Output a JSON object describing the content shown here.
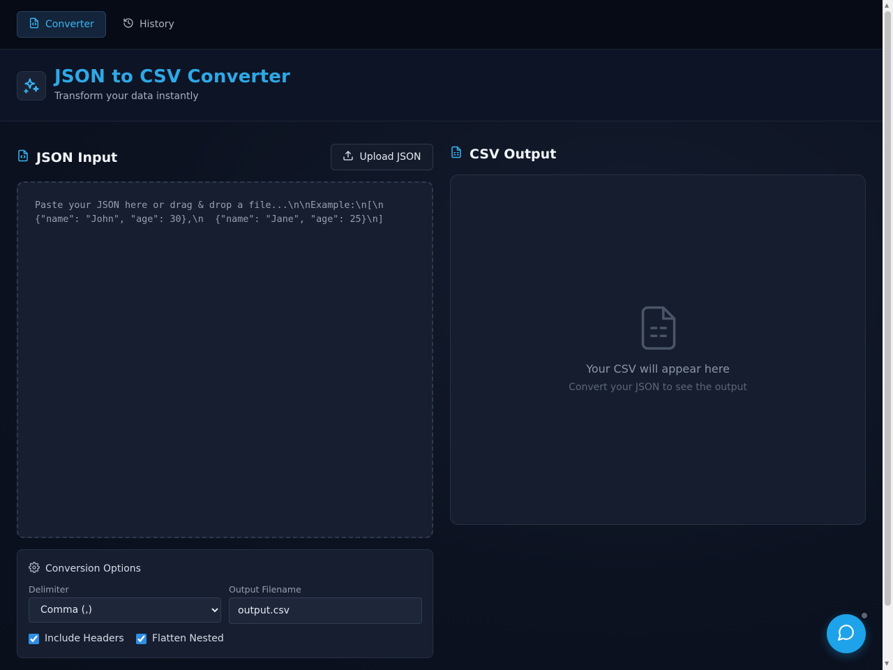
{
  "nav": {
    "converter": "Converter",
    "history": "History"
  },
  "header": {
    "title": "JSON to CSV Converter",
    "subtitle": "Transform your data instantly"
  },
  "input_panel": {
    "title": "JSON Input",
    "upload_label": "Upload JSON",
    "placeholder": "Paste your JSON here or drag & drop a file...\\n\\nExample:\\n[\\n  {\"name\": \"John\", \"age\": 30},\\n  {\"name\": \"Jane\", \"age\": 25}\\n]"
  },
  "output_panel": {
    "title": "CSV Output",
    "empty_title": "Your CSV will appear here",
    "empty_subtitle": "Convert your JSON to see the output"
  },
  "options": {
    "title": "Conversion Options",
    "delimiter_label": "Delimiter",
    "delimiter_value": "Comma (,)",
    "filename_label": "Output Filename",
    "filename_value": "output.csv",
    "include_headers": "Include Headers",
    "include_headers_checked": true,
    "flatten_nested": "Flatten Nested",
    "flatten_nested_checked": true
  },
  "colors": {
    "accent": "#2ea8e6",
    "background": "#0c1220",
    "panel": "#161e30",
    "chat_button": "#1ea3ea"
  },
  "icons": {
    "converter": "file-code-icon",
    "history": "history-icon",
    "logo": "sparkles-icon",
    "upload": "upload-icon",
    "output": "file-spreadsheet-icon",
    "settings": "gear-icon",
    "chat": "chat-bubble-icon"
  }
}
